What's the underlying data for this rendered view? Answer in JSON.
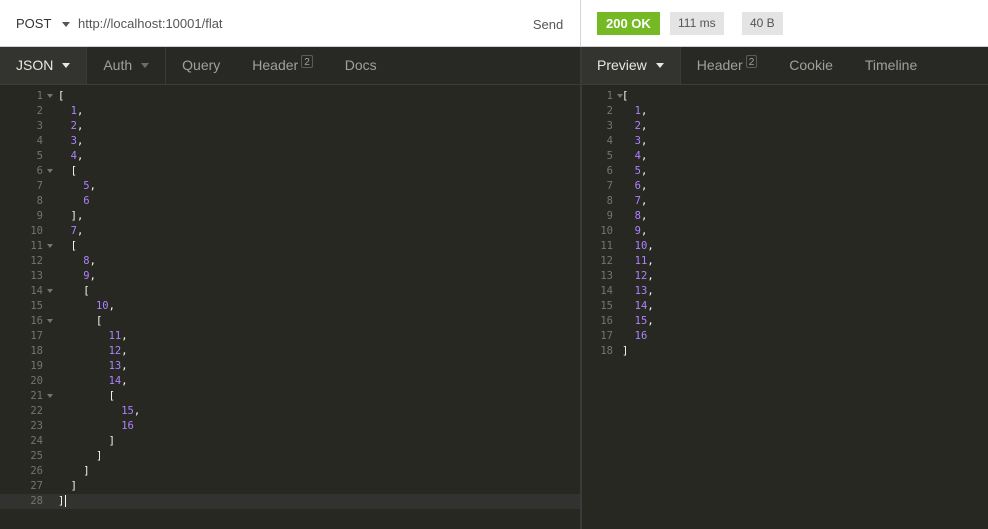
{
  "request": {
    "method": "POST",
    "url": "http://localhost:10001/flat",
    "send_label": "Send"
  },
  "response": {
    "status": "200 OK",
    "time": "111 ms",
    "size": "40 B"
  },
  "request_tabs": [
    {
      "label": "JSON",
      "active": true,
      "caret": true
    },
    {
      "label": "Auth",
      "caret": true
    },
    {
      "label": "Query"
    },
    {
      "label": "Header",
      "badge": "2"
    },
    {
      "label": "Docs"
    }
  ],
  "response_tabs": [
    {
      "label": "Preview",
      "active": true,
      "caret": true
    },
    {
      "label": "Header",
      "badge": "2"
    },
    {
      "label": "Cookie"
    },
    {
      "label": "Timeline"
    }
  ],
  "request_body_lines": [
    "[",
    "  1,",
    "  2,",
    "  3,",
    "  4,",
    "  [",
    "    5,",
    "    6",
    "  ],",
    "  7,",
    "  [",
    "    8,",
    "    9,",
    "    [",
    "      10,",
    "      [",
    "        11,",
    "        12,",
    "        13,",
    "        14,",
    "        [",
    "          15,",
    "          16",
    "        ]",
    "      ]",
    "    ]",
    "  ]",
    "]"
  ],
  "request_fold_lines": [
    1,
    6,
    11,
    14,
    16,
    21
  ],
  "response_body_lines": [
    "[",
    "  1,",
    "  2,",
    "  3,",
    "  4,",
    "  5,",
    "  6,",
    "  7,",
    "  8,",
    "  9,",
    "  10,",
    "  11,",
    "  12,",
    "  13,",
    "  14,",
    "  15,",
    "  16",
    "]"
  ],
  "response_fold_lines": [
    1
  ],
  "colors": {
    "status_ok": "#75ba24",
    "editor_bg": "#272822",
    "number": "#ae81ff"
  }
}
